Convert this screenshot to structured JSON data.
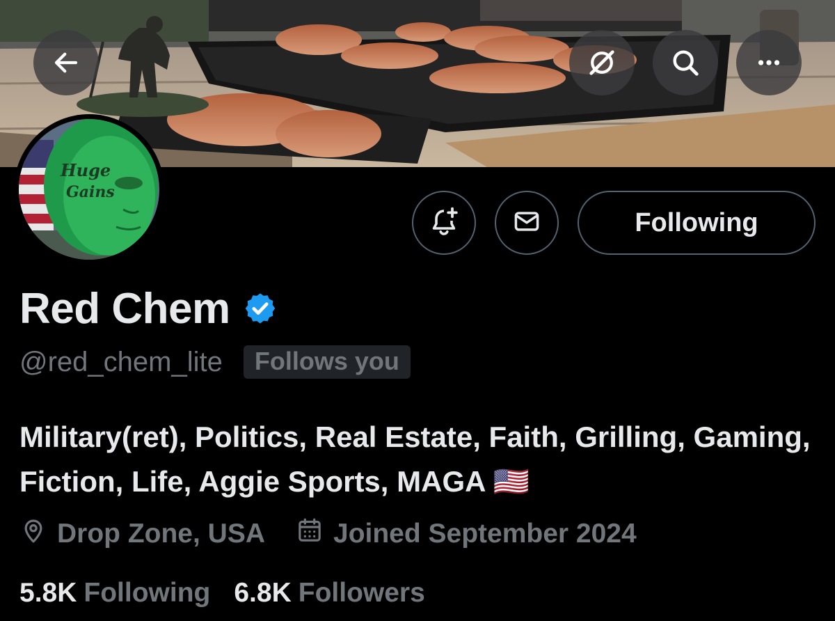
{
  "profile": {
    "display_name": "Red Chem",
    "handle": "@red_chem_lite",
    "follows_you": "Follows you",
    "bio": "Military(ret), Politics, Real Estate, Faith, Grilling, Gaming, Fiction, Life, Aggie Sports, MAGA 🇺🇸",
    "location": "Drop Zone, USA",
    "joined": "Joined September 2024",
    "avatar_text_line1": "Huge",
    "avatar_text_line2": "Gains"
  },
  "stats": {
    "following_count": "5.8K",
    "following_label": "Following",
    "followers_count": "6.8K",
    "followers_label": "Followers"
  },
  "actions": {
    "following_button": "Following"
  },
  "icons": {
    "back": "arrow-left-icon",
    "grok": "grok-icon",
    "search": "search-icon",
    "more": "more-icon",
    "notify": "bell-plus-icon",
    "message": "envelope-icon",
    "verified": "verified-badge-icon",
    "location": "location-pin-icon",
    "calendar": "calendar-icon"
  },
  "colors": {
    "background": "#000000",
    "text_primary": "#e7e9ea",
    "text_secondary": "#71767b",
    "border": "#536471",
    "verified_blue": "#1d9bf0",
    "follows_you_bg": "#202327"
  }
}
